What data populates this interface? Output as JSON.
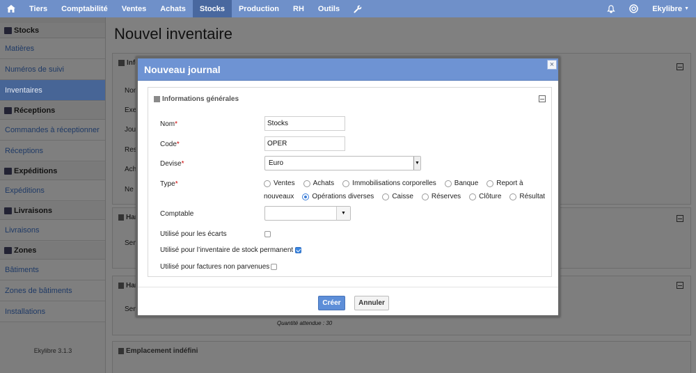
{
  "nav": {
    "items": [
      "Tiers",
      "Comptabilité",
      "Ventes",
      "Achats",
      "Stocks",
      "Production",
      "RH",
      "Outils"
    ],
    "active": "Stocks",
    "user": "Ekylibre"
  },
  "sidebar": {
    "groups": [
      {
        "title": "Stocks",
        "items": [
          "Matières",
          "Numéros de suivi",
          "Inventaires"
        ]
      },
      {
        "title": "Réceptions",
        "items": [
          "Commandes à réceptionner",
          "Réceptions"
        ]
      },
      {
        "title": "Expéditions",
        "items": [
          "Expéditions"
        ]
      },
      {
        "title": "Livraisons",
        "items": [
          "Livraisons"
        ]
      },
      {
        "title": "Zones",
        "items": [
          "Bâtiments",
          "Zones de bâtiments",
          "Installations"
        ]
      }
    ],
    "active_item": "Inventaires",
    "version": "Ekylibre 3.1.3"
  },
  "page": {
    "title": "Nouvel inventaire",
    "bg_labels": {
      "info": "Info",
      "nom": "Nom",
      "exer": "Exerc",
      "jour": "Journ",
      "resp": "Resp",
      "ache": "Ache",
      "nepa": "Ne pa",
      "han1": "Han",
      "seme1": "Seme",
      "han2": "Han",
      "seme2": "Seme",
      "qty": "Quantité attendue : 30",
      "emplacement": "Emplacement indéfini"
    }
  },
  "modal": {
    "title": "Nouveau journal",
    "close": "×",
    "section_title": "Informations générales",
    "fields": {
      "nom": {
        "label": "Nom",
        "value": "Stocks"
      },
      "code": {
        "label": "Code",
        "value": "OPER"
      },
      "devise": {
        "label": "Devise",
        "value": "Euro"
      },
      "type": {
        "label": "Type"
      },
      "comptable": {
        "label": "Comptable",
        "value": ""
      },
      "ecarts": {
        "label": "Utilisé pour les écarts",
        "checked": false
      },
      "inventaire": {
        "label": "Utilisé pour l’inventaire de stock permanent",
        "checked": true
      },
      "factures": {
        "label": "Utilisé pour factures non parvenues",
        "checked": false
      }
    },
    "type_options_row1": [
      "Ventes",
      "Achats",
      "Immobilisations corporelles",
      "Banque",
      "Report à"
    ],
    "type_options_row2": [
      "nouveaux",
      "Opérations diverses",
      "Caisse",
      "Réserves",
      "Clôture",
      "Résultat"
    ],
    "type_selected": "Opérations diverses",
    "required_mark": "*",
    "buttons": {
      "create": "Créer",
      "cancel": "Annuler"
    }
  },
  "colors": {
    "nav": "#6f90c9",
    "nav_active": "#49689f",
    "modal_header": "#6e93d3",
    "primary_button": "#5d8ed8"
  }
}
